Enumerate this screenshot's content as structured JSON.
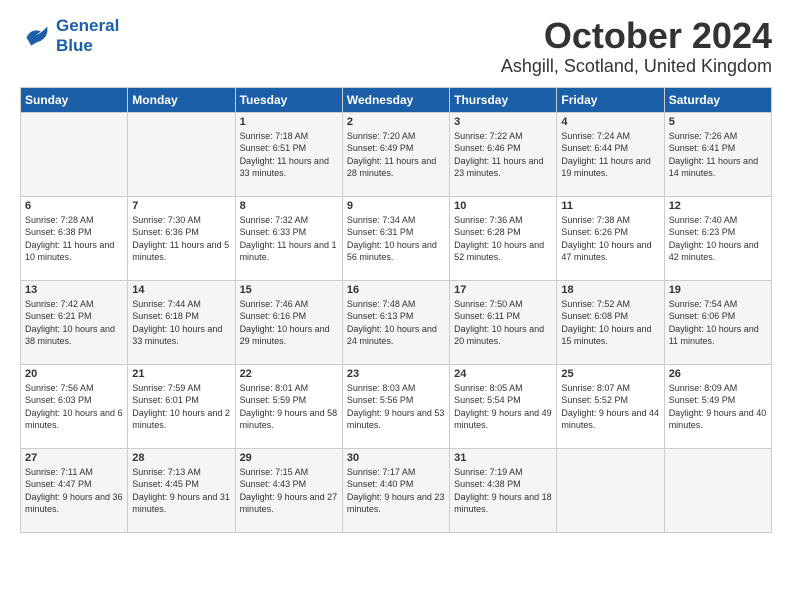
{
  "logo": {
    "line1": "General",
    "line2": "Blue"
  },
  "title": "October 2024",
  "location": "Ashgill, Scotland, United Kingdom",
  "weekdays": [
    "Sunday",
    "Monday",
    "Tuesday",
    "Wednesday",
    "Thursday",
    "Friday",
    "Saturday"
  ],
  "weeks": [
    [
      {
        "day": "",
        "sunrise": "",
        "sunset": "",
        "daylight": ""
      },
      {
        "day": "",
        "sunrise": "",
        "sunset": "",
        "daylight": ""
      },
      {
        "day": "1",
        "sunrise": "Sunrise: 7:18 AM",
        "sunset": "Sunset: 6:51 PM",
        "daylight": "Daylight: 11 hours and 33 minutes."
      },
      {
        "day": "2",
        "sunrise": "Sunrise: 7:20 AM",
        "sunset": "Sunset: 6:49 PM",
        "daylight": "Daylight: 11 hours and 28 minutes."
      },
      {
        "day": "3",
        "sunrise": "Sunrise: 7:22 AM",
        "sunset": "Sunset: 6:46 PM",
        "daylight": "Daylight: 11 hours and 23 minutes."
      },
      {
        "day": "4",
        "sunrise": "Sunrise: 7:24 AM",
        "sunset": "Sunset: 6:44 PM",
        "daylight": "Daylight: 11 hours and 19 minutes."
      },
      {
        "day": "5",
        "sunrise": "Sunrise: 7:26 AM",
        "sunset": "Sunset: 6:41 PM",
        "daylight": "Daylight: 11 hours and 14 minutes."
      }
    ],
    [
      {
        "day": "6",
        "sunrise": "Sunrise: 7:28 AM",
        "sunset": "Sunset: 6:38 PM",
        "daylight": "Daylight: 11 hours and 10 minutes."
      },
      {
        "day": "7",
        "sunrise": "Sunrise: 7:30 AM",
        "sunset": "Sunset: 6:36 PM",
        "daylight": "Daylight: 11 hours and 5 minutes."
      },
      {
        "day": "8",
        "sunrise": "Sunrise: 7:32 AM",
        "sunset": "Sunset: 6:33 PM",
        "daylight": "Daylight: 11 hours and 1 minute."
      },
      {
        "day": "9",
        "sunrise": "Sunrise: 7:34 AM",
        "sunset": "Sunset: 6:31 PM",
        "daylight": "Daylight: 10 hours and 56 minutes."
      },
      {
        "day": "10",
        "sunrise": "Sunrise: 7:36 AM",
        "sunset": "Sunset: 6:28 PM",
        "daylight": "Daylight: 10 hours and 52 minutes."
      },
      {
        "day": "11",
        "sunrise": "Sunrise: 7:38 AM",
        "sunset": "Sunset: 6:26 PM",
        "daylight": "Daylight: 10 hours and 47 minutes."
      },
      {
        "day": "12",
        "sunrise": "Sunrise: 7:40 AM",
        "sunset": "Sunset: 6:23 PM",
        "daylight": "Daylight: 10 hours and 42 minutes."
      }
    ],
    [
      {
        "day": "13",
        "sunrise": "Sunrise: 7:42 AM",
        "sunset": "Sunset: 6:21 PM",
        "daylight": "Daylight: 10 hours and 38 minutes."
      },
      {
        "day": "14",
        "sunrise": "Sunrise: 7:44 AM",
        "sunset": "Sunset: 6:18 PM",
        "daylight": "Daylight: 10 hours and 33 minutes."
      },
      {
        "day": "15",
        "sunrise": "Sunrise: 7:46 AM",
        "sunset": "Sunset: 6:16 PM",
        "daylight": "Daylight: 10 hours and 29 minutes."
      },
      {
        "day": "16",
        "sunrise": "Sunrise: 7:48 AM",
        "sunset": "Sunset: 6:13 PM",
        "daylight": "Daylight: 10 hours and 24 minutes."
      },
      {
        "day": "17",
        "sunrise": "Sunrise: 7:50 AM",
        "sunset": "Sunset: 6:11 PM",
        "daylight": "Daylight: 10 hours and 20 minutes."
      },
      {
        "day": "18",
        "sunrise": "Sunrise: 7:52 AM",
        "sunset": "Sunset: 6:08 PM",
        "daylight": "Daylight: 10 hours and 15 minutes."
      },
      {
        "day": "19",
        "sunrise": "Sunrise: 7:54 AM",
        "sunset": "Sunset: 6:06 PM",
        "daylight": "Daylight: 10 hours and 11 minutes."
      }
    ],
    [
      {
        "day": "20",
        "sunrise": "Sunrise: 7:56 AM",
        "sunset": "Sunset: 6:03 PM",
        "daylight": "Daylight: 10 hours and 6 minutes."
      },
      {
        "day": "21",
        "sunrise": "Sunrise: 7:59 AM",
        "sunset": "Sunset: 6:01 PM",
        "daylight": "Daylight: 10 hours and 2 minutes."
      },
      {
        "day": "22",
        "sunrise": "Sunrise: 8:01 AM",
        "sunset": "Sunset: 5:59 PM",
        "daylight": "Daylight: 9 hours and 58 minutes."
      },
      {
        "day": "23",
        "sunrise": "Sunrise: 8:03 AM",
        "sunset": "Sunset: 5:56 PM",
        "daylight": "Daylight: 9 hours and 53 minutes."
      },
      {
        "day": "24",
        "sunrise": "Sunrise: 8:05 AM",
        "sunset": "Sunset: 5:54 PM",
        "daylight": "Daylight: 9 hours and 49 minutes."
      },
      {
        "day": "25",
        "sunrise": "Sunrise: 8:07 AM",
        "sunset": "Sunset: 5:52 PM",
        "daylight": "Daylight: 9 hours and 44 minutes."
      },
      {
        "day": "26",
        "sunrise": "Sunrise: 8:09 AM",
        "sunset": "Sunset: 5:49 PM",
        "daylight": "Daylight: 9 hours and 40 minutes."
      }
    ],
    [
      {
        "day": "27",
        "sunrise": "Sunrise: 7:11 AM",
        "sunset": "Sunset: 4:47 PM",
        "daylight": "Daylight: 9 hours and 36 minutes."
      },
      {
        "day": "28",
        "sunrise": "Sunrise: 7:13 AM",
        "sunset": "Sunset: 4:45 PM",
        "daylight": "Daylight: 9 hours and 31 minutes."
      },
      {
        "day": "29",
        "sunrise": "Sunrise: 7:15 AM",
        "sunset": "Sunset: 4:43 PM",
        "daylight": "Daylight: 9 hours and 27 minutes."
      },
      {
        "day": "30",
        "sunrise": "Sunrise: 7:17 AM",
        "sunset": "Sunset: 4:40 PM",
        "daylight": "Daylight: 9 hours and 23 minutes."
      },
      {
        "day": "31",
        "sunrise": "Sunrise: 7:19 AM",
        "sunset": "Sunset: 4:38 PM",
        "daylight": "Daylight: 9 hours and 18 minutes."
      },
      {
        "day": "",
        "sunrise": "",
        "sunset": "",
        "daylight": ""
      },
      {
        "day": "",
        "sunrise": "",
        "sunset": "",
        "daylight": ""
      }
    ]
  ]
}
